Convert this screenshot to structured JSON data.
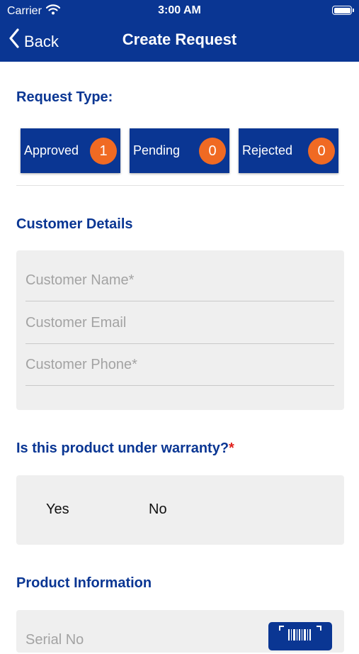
{
  "status_bar": {
    "carrier": "Carrier",
    "time": "3:00 AM"
  },
  "nav": {
    "back_label": "Back",
    "title": "Create Request"
  },
  "request_type": {
    "title": "Request Type:",
    "buttons": [
      {
        "label": "Approved",
        "count": "1"
      },
      {
        "label": "Pending",
        "count": "0"
      },
      {
        "label": "Rejected",
        "count": "0"
      }
    ]
  },
  "customer_details": {
    "title": "Customer Details",
    "name_placeholder": "Customer Name*",
    "email_placeholder": "Customer Email",
    "phone_placeholder": "Customer Phone*"
  },
  "warranty": {
    "question": "Is this product under warranty?",
    "required_mark": "*",
    "options": [
      "Yes",
      "No"
    ]
  },
  "product_information": {
    "title": "Product Information",
    "serial_placeholder": "Serial No"
  },
  "colors": {
    "primary": "#0a3693",
    "badge": "#f06a23",
    "required": "#e1211c",
    "panel_bg": "#efefef"
  },
  "icons": {
    "signal": "wifi-icon",
    "back": "chevron-left-icon",
    "scan": "barcode-icon"
  }
}
